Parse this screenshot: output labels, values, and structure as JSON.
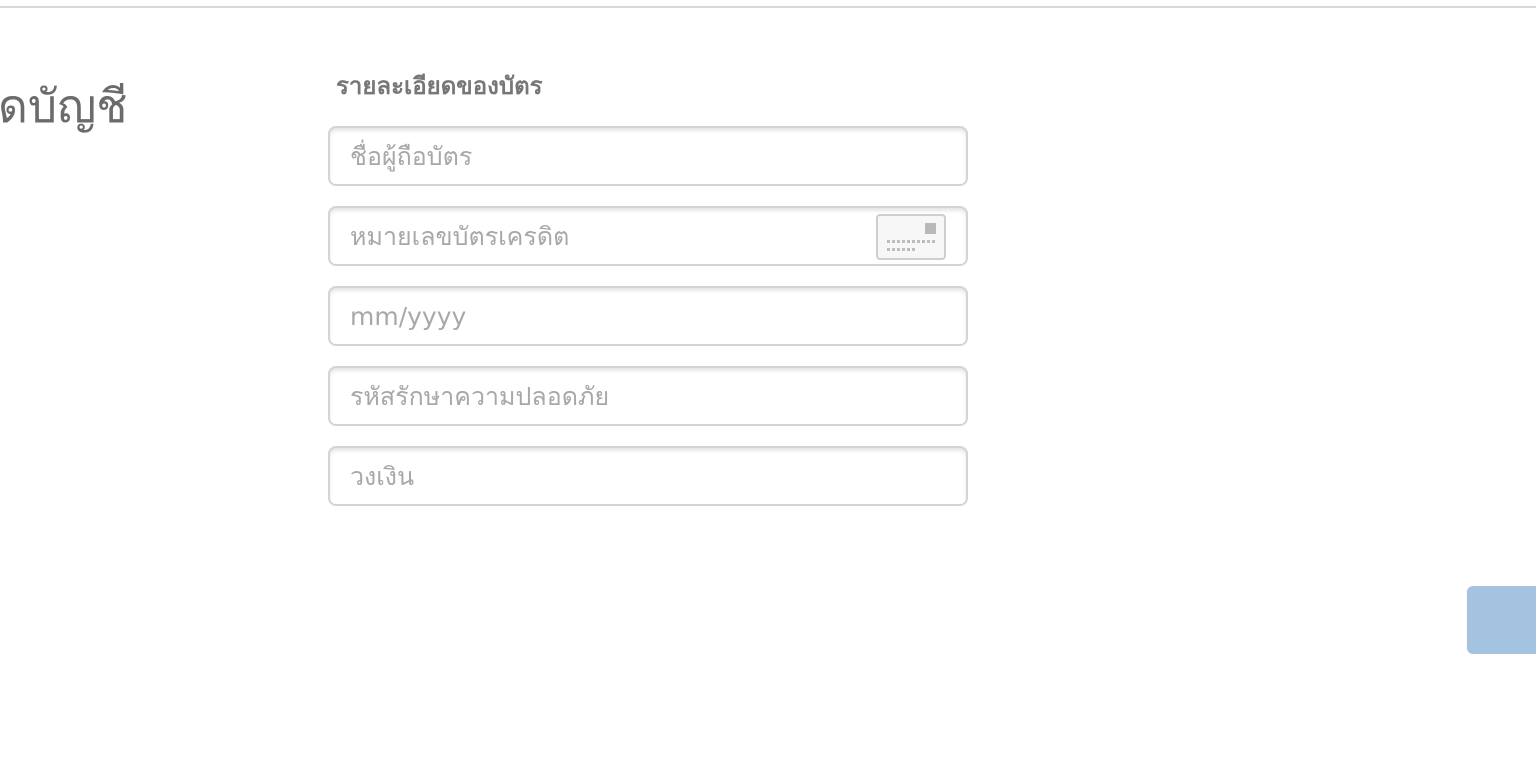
{
  "page": {
    "section_title": "ดบัญชี"
  },
  "card_form": {
    "heading": "รายละเอียดของบัตร",
    "cardholder_name_placeholder": "ชื่อผู้ถือบัตร",
    "card_number_placeholder": "หมายเลขบัตรเครดิต",
    "expiry_placeholder": "mm/yyyy",
    "security_code_placeholder": "รหัสรักษาความปลอดภัย",
    "amount_placeholder": "วงเงิน",
    "card_icon": "credit-card-icon"
  },
  "colors": {
    "accent_button": "#a4c3e1",
    "field_border": "#d4d4d4",
    "heading_text": "#777777"
  }
}
